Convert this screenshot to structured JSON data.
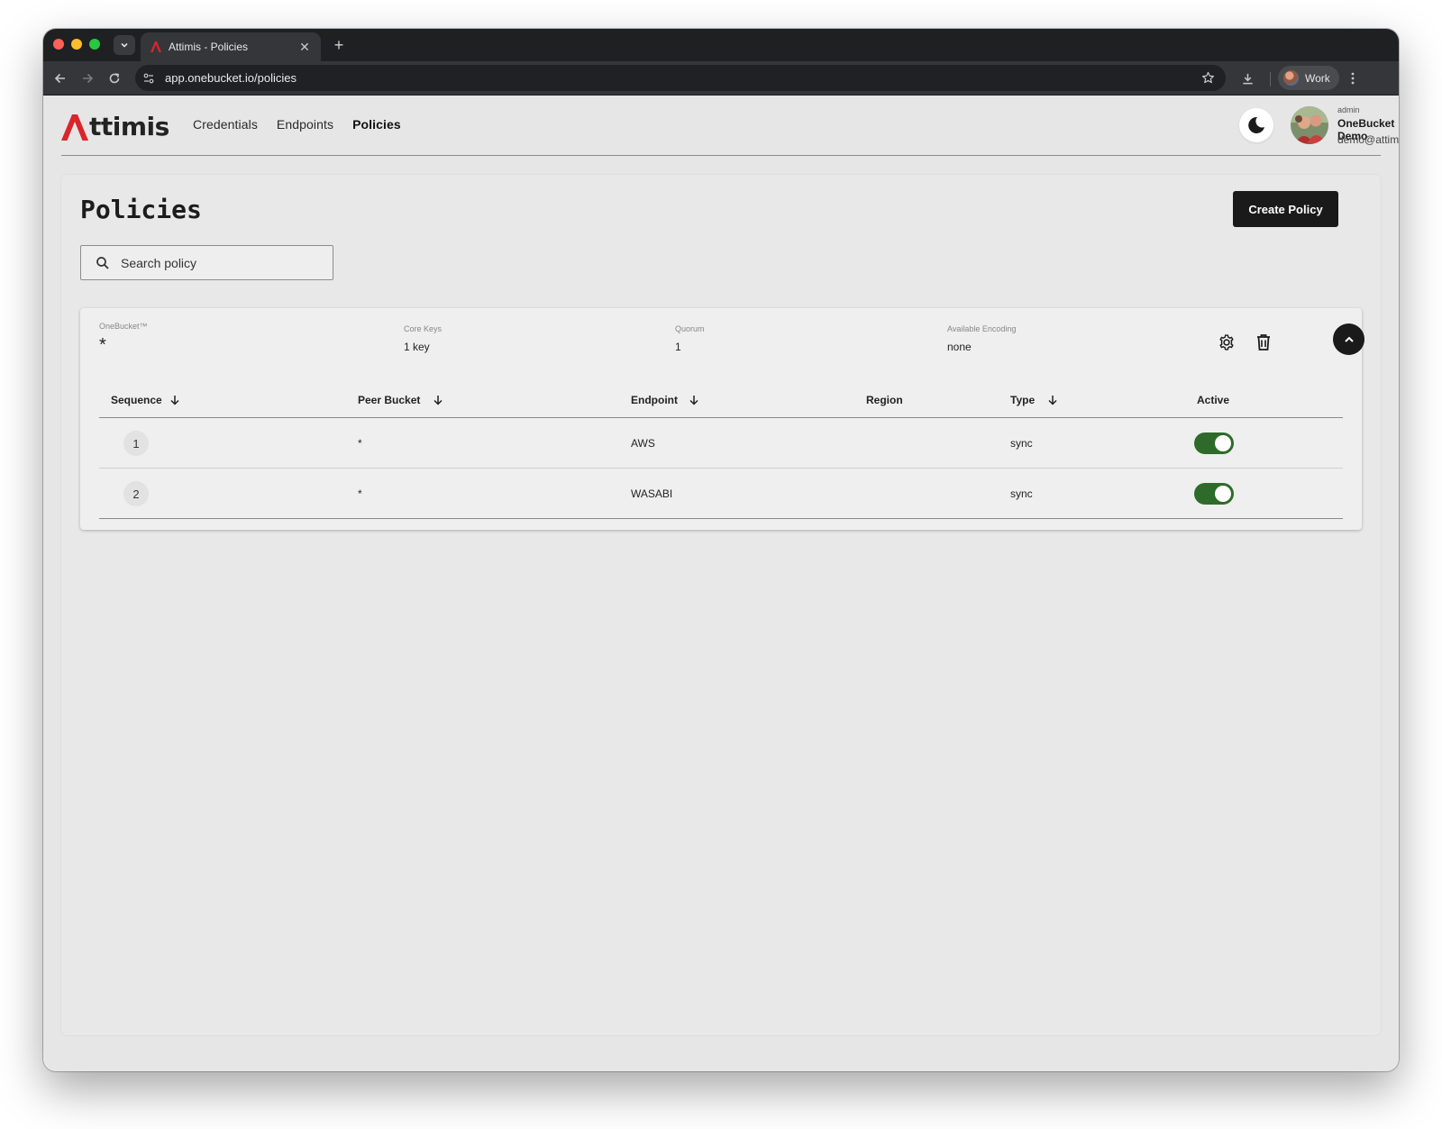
{
  "browser": {
    "tab_title": "Attimis - Policies",
    "url": "app.onebucket.io/policies",
    "profile_name": "Work"
  },
  "app": {
    "brand_first_letter": "A",
    "brand_rest": "ttimis",
    "brand_color": "#d8262b",
    "nav": [
      {
        "label": "Credentials",
        "active": false
      },
      {
        "label": "Endpoints",
        "active": false
      },
      {
        "label": "Policies",
        "active": true
      }
    ],
    "user": {
      "role": "admin",
      "name": "OneBucket Demo",
      "email": "demo@attimis.co"
    }
  },
  "page": {
    "title": "Policies",
    "create_button": "Create Policy",
    "search_placeholder": "Search policy"
  },
  "policy": {
    "bucket_label": "OneBucket™",
    "bucket_value": "*",
    "core_keys_label": "Core Keys",
    "core_keys_value": "1 key",
    "quorum_label": "Quorum",
    "quorum_value": "1",
    "encoding_label": "Available Encoding",
    "encoding_value": "none",
    "columns": [
      "Sequence",
      "Peer Bucket",
      "Endpoint",
      "Region",
      "Type",
      "Active"
    ],
    "rows": [
      {
        "sequence": "1",
        "peer_bucket": "*",
        "endpoint": "AWS",
        "region": "",
        "type": "sync",
        "active": true
      },
      {
        "sequence": "2",
        "peer_bucket": "*",
        "endpoint": "WASABI",
        "region": "",
        "type": "sync",
        "active": true
      }
    ],
    "toggle_on_color": "#2e6b2a"
  },
  "icons": [
    "chevron-down-icon",
    "attimis-favicon",
    "close-icon",
    "plus-icon",
    "back-arrow-icon",
    "forward-arrow-icon",
    "reload-icon",
    "site-settings-icon",
    "bookmark-star-icon",
    "download-icon",
    "more-vert-icon",
    "moon-icon",
    "search-icon",
    "gear-icon",
    "trash-icon",
    "chevron-up-icon",
    "sort-arrow-down-icon"
  ]
}
